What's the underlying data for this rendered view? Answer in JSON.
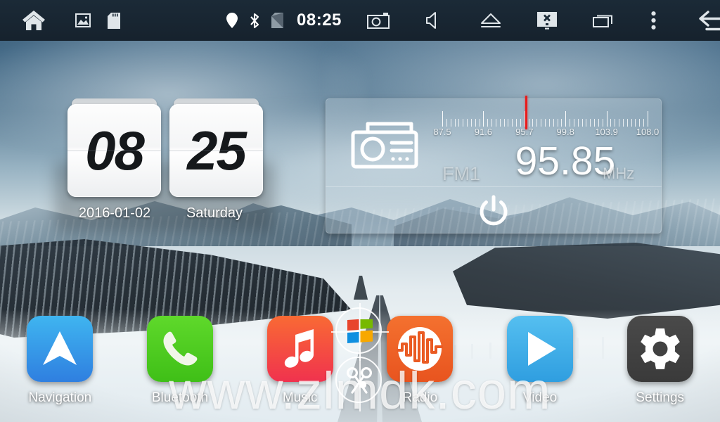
{
  "statusbar": {
    "left_icons": [
      {
        "name": "home-icon",
        "label": "Home"
      },
      {
        "name": "gallery-icon",
        "label": "Gallery"
      },
      {
        "name": "sd-card-icon",
        "label": "SD Card"
      }
    ],
    "center_icons": [
      {
        "name": "location-icon",
        "label": "GPS"
      },
      {
        "name": "bluetooth-icon",
        "label": "Bluetooth"
      },
      {
        "name": "sim-card-icon",
        "label": "SIM"
      }
    ],
    "clock": "08:25",
    "right_icons": [
      {
        "name": "camera-icon",
        "label": "Camera"
      },
      {
        "name": "mute-icon",
        "label": "Mute"
      },
      {
        "name": "eject-icon",
        "label": "Eject"
      },
      {
        "name": "screen-off-icon",
        "label": "Screen Off"
      },
      {
        "name": "recent-apps-icon",
        "label": "Recent Apps"
      },
      {
        "name": "overflow-menu-icon",
        "label": "More"
      },
      {
        "name": "back-icon",
        "label": "Back"
      }
    ]
  },
  "clock_widget": {
    "hours": "08",
    "minutes": "25",
    "date": "2016-01-02",
    "weekday": "Saturday"
  },
  "radio_widget": {
    "icon": "radio-icon",
    "band": "FM1",
    "frequency": "95.85",
    "unit": "MHz",
    "needle_frequency": 95.85,
    "scale": {
      "min": 87.5,
      "max": 108.0,
      "labels": [
        "87.5",
        "91.6",
        "95.7",
        "99.8",
        "103.9",
        "108.0"
      ],
      "values": [
        87.5,
        91.6,
        95.7,
        99.8,
        103.9,
        108.0
      ]
    },
    "needle_color": "#e81c1c",
    "power_button": "power-icon"
  },
  "dock": {
    "items": [
      {
        "label": "Navigation",
        "icon": "navigation-arrow-icon",
        "color": "#3fb5f0"
      },
      {
        "label": "Bluetooth",
        "icon": "phone-handset-icon",
        "color": "#5fd92b"
      },
      {
        "label": "Music",
        "icon": "music-note-icon",
        "color": "#f96a34"
      },
      {
        "label": "Radio",
        "icon": "audio-waveform-icon",
        "color": "#f4712f"
      },
      {
        "label": "Video",
        "icon": "play-triangle-icon",
        "color": "#55bff0"
      },
      {
        "label": "Settings",
        "icon": "gear-icon",
        "color": "#4a4a4a"
      }
    ]
  },
  "overlays": {
    "windows_badge": "windows-logo-icon",
    "scissors_badge": "scissors-icon"
  },
  "watermark": "www.zlmdk.com"
}
